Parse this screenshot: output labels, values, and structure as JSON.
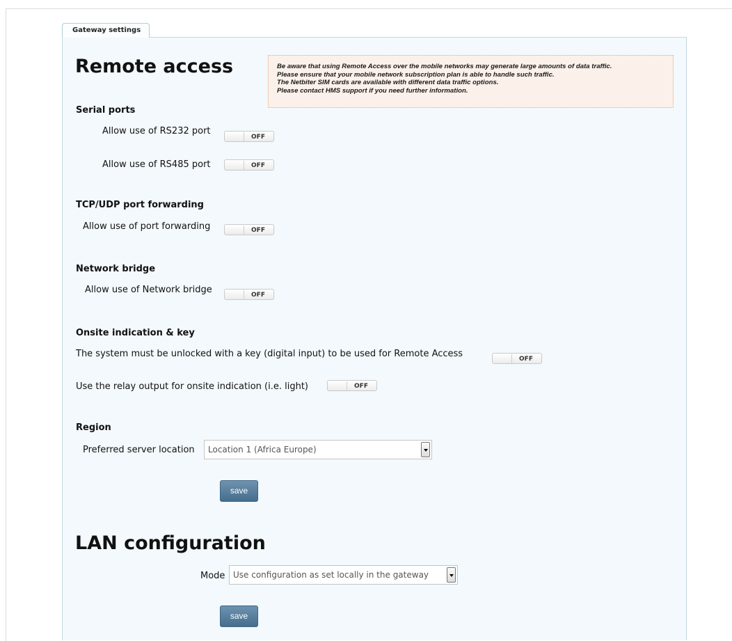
{
  "tab": {
    "label": "Gateway settings"
  },
  "remote_access": {
    "title": "Remote access",
    "warning": [
      "Be aware that using Remote Access over the mobile networks may generate large amounts of data traffic.",
      "Please ensure that your mobile network subscription plan is able to handle such traffic.",
      "The Netbiter SIM cards are available with different data traffic options.",
      "Please contact HMS support if you need further information."
    ],
    "serial_ports": {
      "heading": "Serial ports",
      "rs232_label": "Allow use of RS232 port",
      "rs232_state": "OFF",
      "rs485_label": "Allow use of RS485 port",
      "rs485_state": "OFF"
    },
    "port_forwarding": {
      "heading": "TCP/UDP port forwarding",
      "label": "Allow use of port forwarding",
      "state": "OFF"
    },
    "network_bridge": {
      "heading": "Network bridge",
      "label": "Allow use of Network bridge",
      "state": "OFF"
    },
    "onsite": {
      "heading": "Onsite indication & key",
      "key_label": "The system must be unlocked with a key (digital input) to be used for Remote Access",
      "key_state": "OFF",
      "relay_label": "Use the relay output for onsite indication (i.e. light)",
      "relay_state": "OFF"
    },
    "region": {
      "heading": "Region",
      "label": "Preferred server location",
      "selected": "Location 1 (Africa Europe)"
    },
    "save_label": "save"
  },
  "lan": {
    "title": "LAN configuration",
    "mode_label": "Mode",
    "mode_selected": "Use configuration as set locally in the gateway",
    "save_label": "save"
  },
  "colors": {
    "panel_bg": "#f3f9fc",
    "warning_bg": "#fbf1ea",
    "button": "#557d9c"
  }
}
